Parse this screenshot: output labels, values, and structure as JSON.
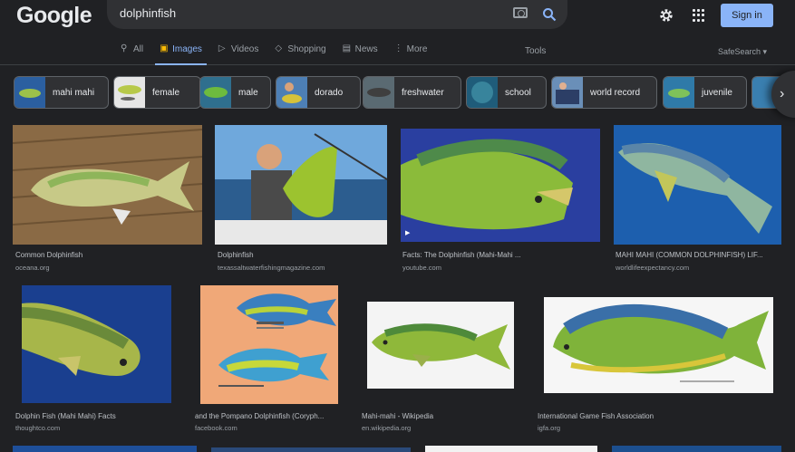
{
  "header": {
    "logo": "Google",
    "search_value": "dolphinfish",
    "signin_label": "Sign in",
    "tools_label": "Tools",
    "safesearch_label": "SafeSearch"
  },
  "tabs": [
    {
      "label": "All",
      "icon": "search-icon"
    },
    {
      "label": "Images",
      "icon": "image-icon"
    },
    {
      "label": "Videos",
      "icon": "video-icon"
    },
    {
      "label": "Shopping",
      "icon": "tag-icon"
    },
    {
      "label": "News",
      "icon": "news-icon"
    },
    {
      "label": "More",
      "icon": "more-vert-icon"
    }
  ],
  "chips": [
    {
      "label": "mahi mahi"
    },
    {
      "label": "female"
    },
    {
      "label": "male"
    },
    {
      "label": "dorado"
    },
    {
      "label": "freshwater"
    },
    {
      "label": "school"
    },
    {
      "label": "world record"
    },
    {
      "label": "juvenile"
    }
  ],
  "results": [
    {
      "title": "Common Dolphinfish",
      "site": "oceana.org"
    },
    {
      "title": "Dolphinfish",
      "site": "texassaltwaterfishingmagazine.com"
    },
    {
      "title": "Facts: The Dolphinfish (Mahi-Mahi ...",
      "site": "youtube.com"
    },
    {
      "title": "MAHI MAHI (COMMON DOLPHINFISH) LIF...",
      "site": "worldlifeexpectancy.com"
    },
    {
      "title": "Dolphin Fish (Mahi Mahi) Facts",
      "site": "thoughtco.com"
    },
    {
      "title": "and the Pompano Dolphinfish (Coryph...",
      "site": "facebook.com"
    },
    {
      "title": "Mahi-mahi - Wikipedia",
      "site": "en.wikipedia.org"
    },
    {
      "title": "International Game Fish Association",
      "site": "igfa.org"
    }
  ],
  "colors": {
    "background": "#202124",
    "accent": "#8ab4f8",
    "fish_green": "#8fb83a",
    "fish_blue": "#2a5f9e"
  }
}
